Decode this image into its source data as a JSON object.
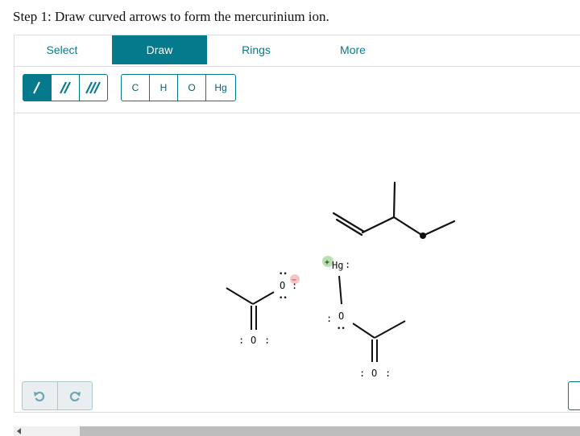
{
  "title": "Step 1: Draw curved arrows to form the mercurinium ion.",
  "tabs": [
    {
      "label": "Select",
      "active": false
    },
    {
      "label": "Draw",
      "active": true
    },
    {
      "label": "Rings",
      "active": false
    },
    {
      "label": "More",
      "active": false
    }
  ],
  "bond_tools": [
    {
      "icon": "single-bond-icon",
      "selected": true
    },
    {
      "icon": "double-bond-icon",
      "selected": false
    },
    {
      "icon": "triple-bond-icon",
      "selected": false
    }
  ],
  "atom_tools": [
    "C",
    "H",
    "O",
    "Hg"
  ],
  "molecule": {
    "hg_label": "Hg",
    "hg_charge": "+",
    "oxygen_label": "O",
    "oxygen_charge": "−",
    "lone_pair": ":",
    "lone_pair_dots": "••"
  },
  "colors": {
    "accent": "#047a8c",
    "positive_charge": "#b9e0b1",
    "negative_charge": "#f5c4c4"
  },
  "history": {
    "undo_icon": "undo-icon",
    "redo_icon": "redo-icon"
  }
}
